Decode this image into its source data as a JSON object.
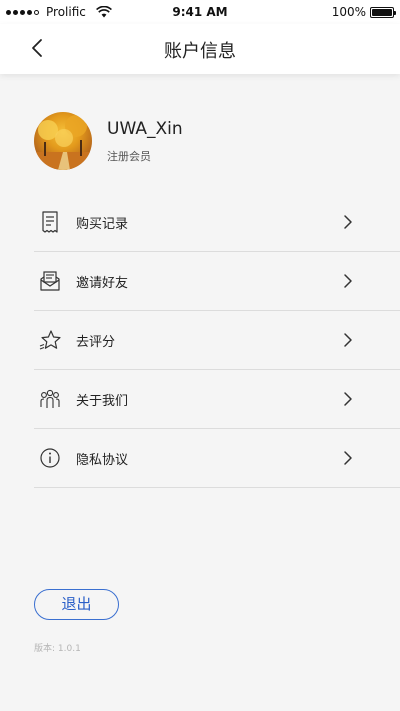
{
  "status_bar": {
    "carrier": "Prolific",
    "time": "9:41 AM",
    "battery": "100%",
    "battery_level": 1.0
  },
  "nav": {
    "title": "账户信息",
    "back_icon": "chevron-left-icon"
  },
  "profile": {
    "username": "UWA_Xin",
    "level": "注册会员"
  },
  "menu": {
    "items": [
      {
        "label": "购买记录",
        "icon": "receipt-icon"
      },
      {
        "label": "邀请好友",
        "icon": "envelope-icon"
      },
      {
        "label": "去评分",
        "icon": "star-icon"
      },
      {
        "label": "关于我们",
        "icon": "people-icon"
      },
      {
        "label": "隐私协议",
        "icon": "info-icon"
      }
    ]
  },
  "logout_label": "退出",
  "version": "版本: 1.0.1",
  "colors": {
    "accent": "#2a5fc8",
    "background": "#f5f5f5",
    "divider": "#dcdcdc"
  }
}
